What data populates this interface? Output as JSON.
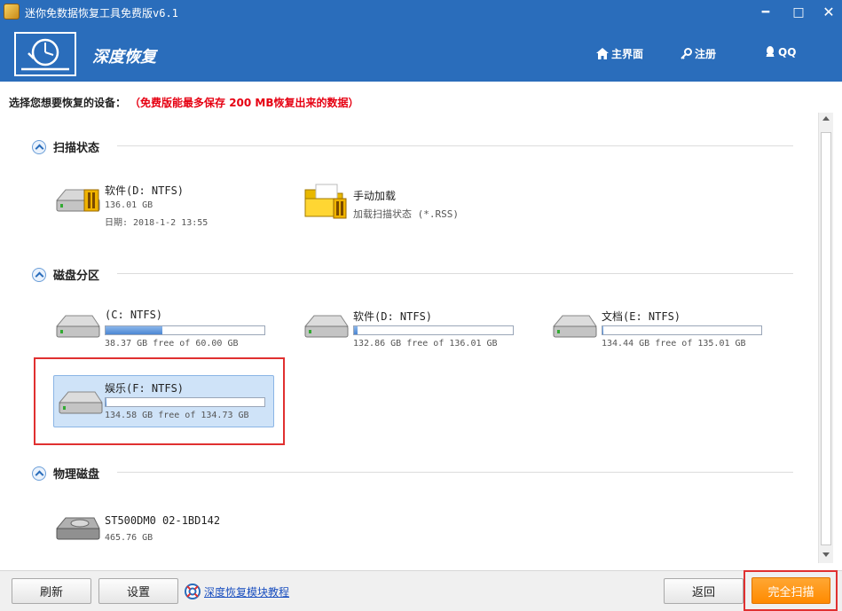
{
  "window": {
    "title": "迷你免数据恢复工具免费版v6.1",
    "minimize": "━",
    "maximize": "□",
    "close": "✕"
  },
  "header": {
    "brand": "深度恢复",
    "nav": {
      "home": "主界面",
      "register": "注册",
      "qq": "QQ"
    }
  },
  "instruction": {
    "text": "选择您想要恢复的设备：",
    "warning": "（免费版能最多保存 200 MB恢复出来的数据）"
  },
  "sections": {
    "scan_status": {
      "title": "扫描状态",
      "items": {
        "software_d": {
          "name": "软件(D: NTFS)",
          "size": "136.01 GB",
          "date": "日期: 2018-1-2 13:55"
        },
        "manual_load": {
          "name": "手动加载",
          "desc": "加载扫描状态 (*.RSS)"
        }
      }
    },
    "partitions": {
      "title": "磁盘分区",
      "items": {
        "c": {
          "name": "(C: NTFS)",
          "free": "38.37 GB free of 60.00 GB",
          "used_fraction": 0.36
        },
        "d": {
          "name": "软件(D: NTFS)",
          "free": "132.86 GB free of 136.01 GB",
          "used_fraction": 0.023
        },
        "e": {
          "name": "文档(E: NTFS)",
          "free": "134.44 GB free of 135.01 GB",
          "used_fraction": 0.004
        },
        "f": {
          "name": "娱乐(F: NTFS)",
          "free": "134.58 GB free of 134.73 GB",
          "used_fraction": 0.001
        }
      }
    },
    "physical": {
      "title": "物理磁盘",
      "items": {
        "disk0": {
          "name": "ST500DM0 02-1BD142",
          "size": "465.76 GB"
        }
      }
    }
  },
  "toolbar": {
    "refresh": "刷新",
    "settings": "设置",
    "tutorial": "深度恢复模块教程",
    "back": "返回",
    "full_scan": "完全扫描"
  },
  "colors": {
    "brand_blue": "#2a6dbb",
    "warning_red": "#e60012",
    "scan_orange": "#ff8a00",
    "highlight_red": "#e03030"
  }
}
